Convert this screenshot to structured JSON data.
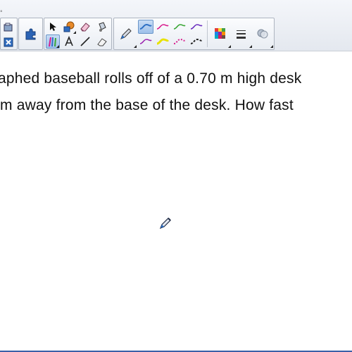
{
  "toolbar": {
    "top_marker": "°",
    "buttons": [
      "screen-capture-icon",
      "close-doc-icon",
      "puzzle-icon",
      "select-arrow-icon",
      "shapes-icon",
      "eraser-icon",
      "fill-icon",
      "creative-pens-icon",
      "text-icon",
      "line-icon",
      "magic-eraser-icon",
      "pen-icon",
      "properties-icon",
      "color-palette-icon",
      "line-width-icon",
      "fill-opacity-icon"
    ],
    "pen_colors": {
      "row1": [
        "#2d6fc4",
        "#d81b8c",
        "#3aa635",
        "#6a2dbf"
      ],
      "row2": [
        "#9c27b0",
        "#e8e200",
        "#d81b8c",
        "#222222"
      ]
    },
    "active_pen_index": 0
  },
  "canvas": {
    "line1": "aphed baseball rolls off of a 0.70 m high desk",
    "line2": "m away from the base of the desk. How fast"
  },
  "cursor": "pen-cursor-icon"
}
